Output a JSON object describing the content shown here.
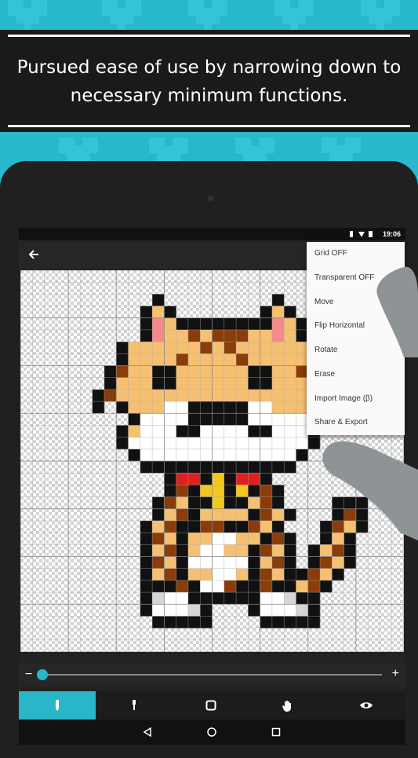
{
  "banner": {
    "line1": "Pursued ease of use by narrowing down to",
    "line2": "necessary minimum functions."
  },
  "status": {
    "time": "19:06",
    "icons": "vibrate wifi battery"
  },
  "appbar": {
    "back_icon": "arrow-back-icon"
  },
  "menu": {
    "items": [
      "Grid OFF",
      "Transparent OFF",
      "Move",
      "Flip Horizontal",
      "Rotate",
      "Erase",
      "Import Image (β)",
      "Share & Export"
    ]
  },
  "zoom": {
    "minus": "−",
    "plus": "+",
    "level": 0.0
  },
  "toolbar": {
    "tools": [
      "pen-icon",
      "dropper-icon",
      "square-icon",
      "hand-icon",
      "eye-icon"
    ],
    "active": 0
  },
  "navbar": {
    "buttons": [
      "back-triangle-icon",
      "home-circle-icon",
      "recents-square-icon"
    ]
  },
  "colors": {
    "accent": "#29b6c8",
    "background": "#27b8cc",
    "orange": "#f5c072",
    "brown": "#8a3c0a",
    "pink": "#f48a8a",
    "red": "#e0201e",
    "gold": "#f2c81e",
    "black": "#111111",
    "white": "#ffffff",
    "grey": "#c8c8c8"
  },
  "pixel_art": {
    "palette": {
      ".": null,
      "K": "#111111",
      "O": "#f5c072",
      "B": "#8a3c0a",
      "P": "#f48a8a",
      "W": "#ffffff",
      "R": "#e0201e",
      "Y": "#f2c81e",
      "G": "#d6d6d6"
    },
    "rows": [
      "................................",
      "................................",
      "...........K.........K..........",
      "..........KOK.......KOK.........",
      "..........KPOKKKKKKKKPOK........",
      "..........KPOOBOBBBOOPOK........",
      "........KOOOOOOBOBOOOOOOK.......",
      "........KOOOOBOOOOBOOOOOK.......",
      ".......KBOOKKOOOOOOKKOOBK.......",
      ".......KOOOKKOOOOOOKKOOOOK......",
      "......KBOOOOOOOOOOOOOOOOOK......",
      "......K.KOOOWWKKKKKWWOOOK.......",
      ".........KWWWWKKKKKWWWWWK.......",
      "........KOWWWKKWWWWKKWWWK.......",
      "........KWWWWWWWWWWWWWWWK.......",
      ".........KWWWWWWWWWWWWWK........",
      "..........KKKKKKKKKKKKK.........",
      "............KRRKYKRRK...........",
      "............KBKYYKYKBK..........",
      "...........KBOKKYKKOBK....KKK...",
      "...........KOBKOOOOKBOK...KBK...",
      "..........KOBKKBBKKBOK...KBOK...",
      "..........KBOKOOWWOOKBK..KOK....",
      "..........KOBKOWWOOKBOK.KOBK....",
      "..........KBOKWWWWWKOBK.KBOK....",
      "..........KOBKOOWWOKBOKKBOK.....",
      "..........KKKBKWWBKKBKKOBK......",
      "..........KGWWKKKKKKWWGKK.......",
      "..........KWWWGK...KWWWGK.......",
      "...........KKKKK....KKKKK.......",
      "................................",
      "................................"
    ]
  }
}
